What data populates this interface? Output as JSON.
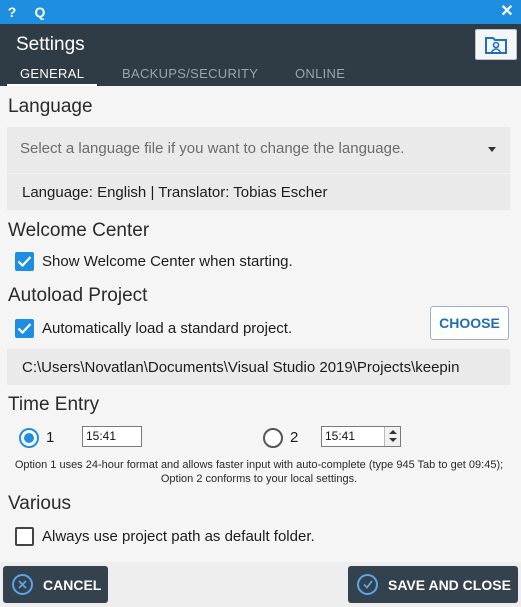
{
  "titlebar": {
    "help_label": "?",
    "q_label": "Q",
    "close_label": "✕"
  },
  "header": {
    "title": "Settings",
    "tabs": [
      {
        "label": "GENERAL",
        "active": true
      },
      {
        "label": "BACKUPS/SECURITY",
        "active": false
      },
      {
        "label": "ONLINE",
        "active": false
      }
    ]
  },
  "language": {
    "title": "Language",
    "select_placeholder": "Select a language file if you want to change the language.",
    "info": "Language: English | Translator: Tobias Escher"
  },
  "welcome": {
    "title": "Welcome Center",
    "checkbox_label": "Show Welcome Center when starting.",
    "checked": true
  },
  "autoload": {
    "title": "Autoload Project",
    "checkbox_label": "Automatically load a standard project.",
    "checked": true,
    "choose_label": "CHOOSE",
    "path": "C:\\Users\\Novatlan\\Documents\\Visual Studio 2019\\Projects\\keepin"
  },
  "time_entry": {
    "title": "Time Entry",
    "option1_label": "1",
    "option1_value": "15:41",
    "option2_label": "2",
    "option2_value": "15:41",
    "selected": 1,
    "hint": "Option 1 uses 24-hour format and allows faster input with auto-complete (type 945 Tab to get 09:45); Option 2 conforms to your local settings."
  },
  "various": {
    "title": "Various",
    "checkbox_label": "Always use project path as default folder.",
    "checked": false
  },
  "footer": {
    "cancel_label": "CANCEL",
    "save_label": "SAVE AND CLOSE"
  },
  "colors": {
    "accent": "#1e8fe0",
    "header_bg": "#2f3b45",
    "button_bg": "#34424e"
  }
}
